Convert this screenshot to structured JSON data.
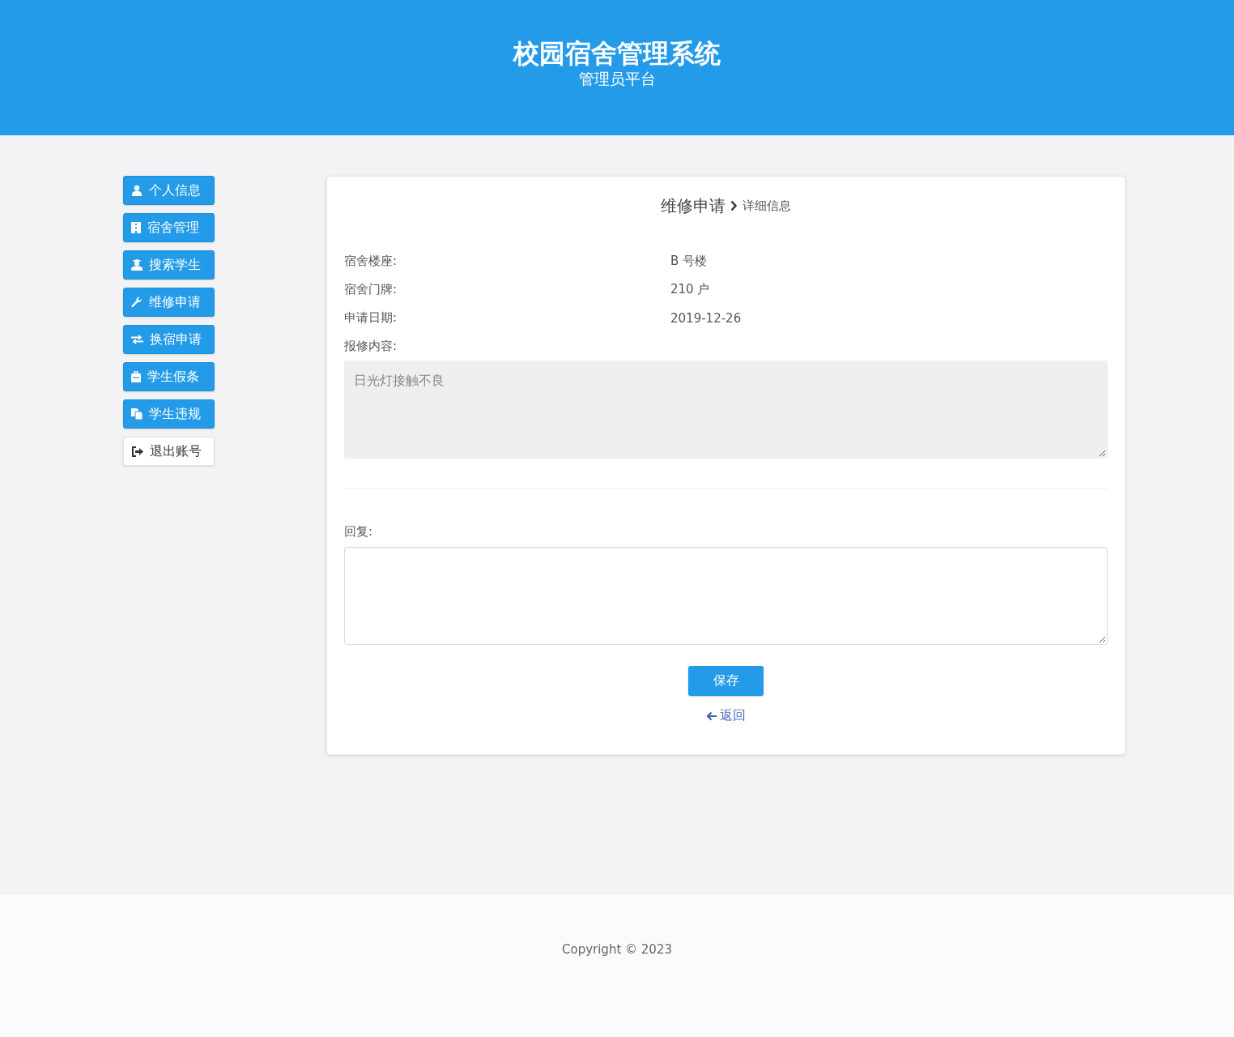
{
  "header": {
    "title": "校园宿舍管理系统",
    "subtitle": "管理员平台"
  },
  "sidebar": {
    "items": [
      {
        "label": "个人信息",
        "kind": "primary"
      },
      {
        "label": "宿舍管理",
        "kind": "primary"
      },
      {
        "label": "搜索学生",
        "kind": "primary"
      },
      {
        "label": "维修申请",
        "kind": "primary"
      },
      {
        "label": "换宿申请",
        "kind": "primary"
      },
      {
        "label": "学生假条",
        "kind": "primary"
      },
      {
        "label": "学生违规",
        "kind": "primary"
      },
      {
        "label": "退出账号",
        "kind": "default"
      }
    ]
  },
  "detail": {
    "breadcrumb": {
      "section": "维修申请",
      "page": "详细信息"
    },
    "fields": [
      {
        "label": "宿舍楼座:",
        "value": "B 号楼"
      },
      {
        "label": "宿舍门牌:",
        "value": "210 户"
      },
      {
        "label": "申请日期:",
        "value": "2019-12-26"
      }
    ],
    "content": {
      "label": "报修内容:",
      "value": "日光灯接触不良",
      "disabled": true
    },
    "reply": {
      "label": "回复:"
    },
    "save_button": "保存",
    "back_link": "返回"
  },
  "footer": {
    "copyright": "Copyright © 2023"
  }
}
